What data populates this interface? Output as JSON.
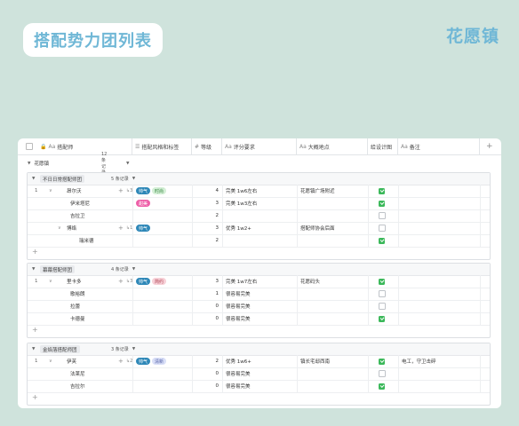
{
  "title": "搭配势力团列表",
  "brand": "花愿镇",
  "columns": [
    "搭配师",
    "搭配风格和标签",
    "等级",
    "评分要求",
    "大概地点",
    "给设计图",
    "备注"
  ],
  "column_icons": [
    "Aa",
    "☰",
    "#",
    "Aa",
    "Aa",
    "",
    "Aa"
  ],
  "top_group": {
    "name": "花愿镇",
    "count": "12 条记录"
  },
  "groups": [
    {
      "name": "不日日常搭配师团",
      "count": "5 条记录",
      "rows": [
        {
          "idx": "1",
          "name": "昂尔沃",
          "expand": true,
          "sub": "3",
          "tags": [
            {
              "t": "帅气",
              "c": "t-blue"
            },
            {
              "t": "时尚",
              "c": "t-green"
            }
          ],
          "level": "4",
          "score": "完美 1w6左右",
          "place": "花愿镇广场附近",
          "design": true,
          "note": ""
        },
        {
          "idx": "",
          "name": "伊米塔尼",
          "expand": false,
          "sub": "",
          "tags": [
            {
              "t": "甜美",
              "c": "t-pink"
            }
          ],
          "level": "3",
          "score": "完美 1w3左右",
          "place": "",
          "design": true,
          "note": ""
        },
        {
          "idx": "",
          "name": "吉拉卫",
          "expand": false,
          "sub": "",
          "tags": [],
          "level": "2",
          "score": "",
          "place": "",
          "design": false,
          "note": ""
        },
        {
          "idx": "",
          "name": "博络",
          "expand": true,
          "sub": "1",
          "tags": [
            {
              "t": "帅气",
              "c": "t-blue"
            }
          ],
          "level": "3",
          "score": "优秀 1w2+",
          "place": "搭配师协会后面",
          "design": false,
          "note": ""
        },
        {
          "idx": "",
          "name": "瑞米德",
          "expand": false,
          "sub": "",
          "tags": [],
          "level": "2",
          "score": "",
          "place": "",
          "design": true,
          "note": ""
        }
      ]
    },
    {
      "name": "幕幕搭配师团",
      "count": "4 条记录",
      "rows": [
        {
          "idx": "1",
          "name": "里卡多",
          "expand": true,
          "sub": "3",
          "tags": [
            {
              "t": "帅气",
              "c": "t-blue"
            },
            {
              "t": "简约",
              "c": "t-rose"
            }
          ],
          "level": "3",
          "score": "完美 1w7左右",
          "place": "花愿码头",
          "design": true,
          "note": ""
        },
        {
          "idx": "",
          "name": "歌裕朗",
          "expand": false,
          "sub": "",
          "tags": [],
          "level": "1",
          "score": "很容易完美",
          "place": "",
          "design": false,
          "note": ""
        },
        {
          "idx": "",
          "name": "拉蕾",
          "expand": false,
          "sub": "",
          "tags": [],
          "level": "0",
          "score": "很容易完美",
          "place": "",
          "design": false,
          "note": ""
        },
        {
          "idx": "",
          "name": "卡德曼",
          "expand": false,
          "sub": "",
          "tags": [],
          "level": "0",
          "score": "很容易完美",
          "place": "",
          "design": true,
          "note": ""
        }
      ]
    },
    {
      "name": "金焰落搭配师团",
      "count": "3 条记录",
      "rows": [
        {
          "idx": "1",
          "name": "伊芙",
          "expand": true,
          "sub": "2",
          "tags": [
            {
              "t": "帅气",
              "c": "t-blue"
            },
            {
              "t": "清新",
              "c": "t-lav"
            }
          ],
          "level": "2",
          "score": "优秀 1w6+",
          "place": "镇长宅邸西南",
          "design": true,
          "note": "电工，守卫击碎"
        },
        {
          "idx": "",
          "name": "法莱尼",
          "expand": false,
          "sub": "",
          "tags": [],
          "level": "0",
          "score": "很容易完美",
          "place": "",
          "design": false,
          "note": ""
        },
        {
          "idx": "",
          "name": "吉拉尔",
          "expand": false,
          "sub": "",
          "tags": [],
          "level": "0",
          "score": "很容易完美",
          "place": "",
          "design": true,
          "note": ""
        }
      ]
    }
  ]
}
